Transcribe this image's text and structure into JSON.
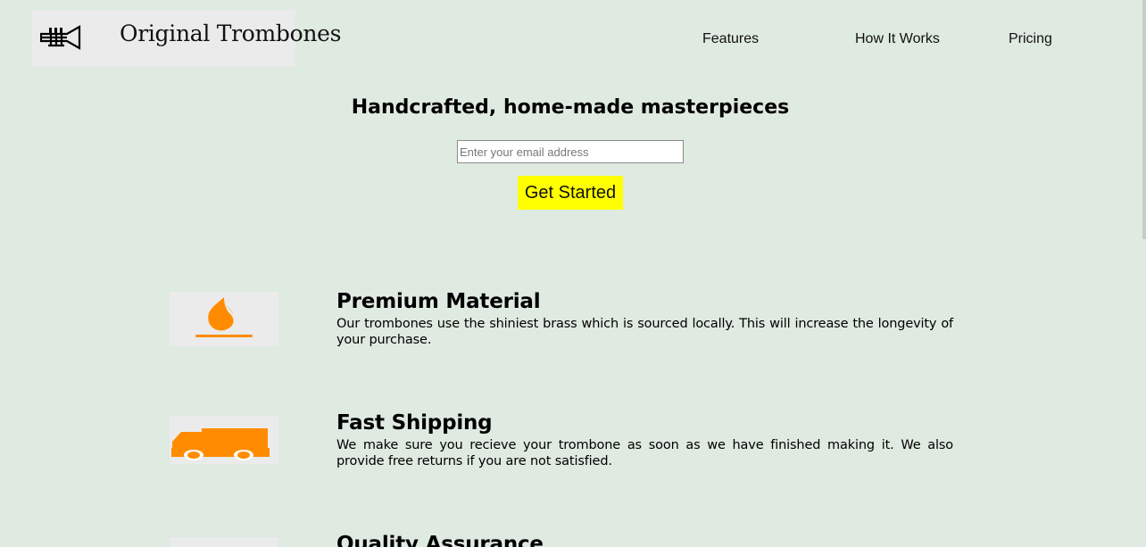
{
  "brand": {
    "name": "Original Trombones",
    "logo_icon": "trumpet-icon"
  },
  "nav": {
    "items": [
      {
        "label": "Features"
      },
      {
        "label": "How It Works"
      },
      {
        "label": "Pricing"
      }
    ]
  },
  "hero": {
    "title": "Handcrafted, home-made masterpieces",
    "email_placeholder": "Enter your email address",
    "email_value": "",
    "cta_label": "Get Started"
  },
  "features": [
    {
      "icon": "fire-icon",
      "title": "Premium Material",
      "description": "Our trombones use the shiniest brass which is sourced locally. This will increase the longevity of your purchase."
    },
    {
      "icon": "truck-icon",
      "title": "Fast Shipping",
      "description": "We make sure you recieve your trombone as soon as we have finished making it. We also provide free returns if you are not satisfied."
    },
    {
      "icon": "medal-icon",
      "title": "Quality Assurance",
      "description": ""
    }
  ],
  "colors": {
    "background": "#dfeae0",
    "cta": "#ffff00",
    "icon_accent": "#ff8c00",
    "image_bg": "#ebebeb"
  }
}
